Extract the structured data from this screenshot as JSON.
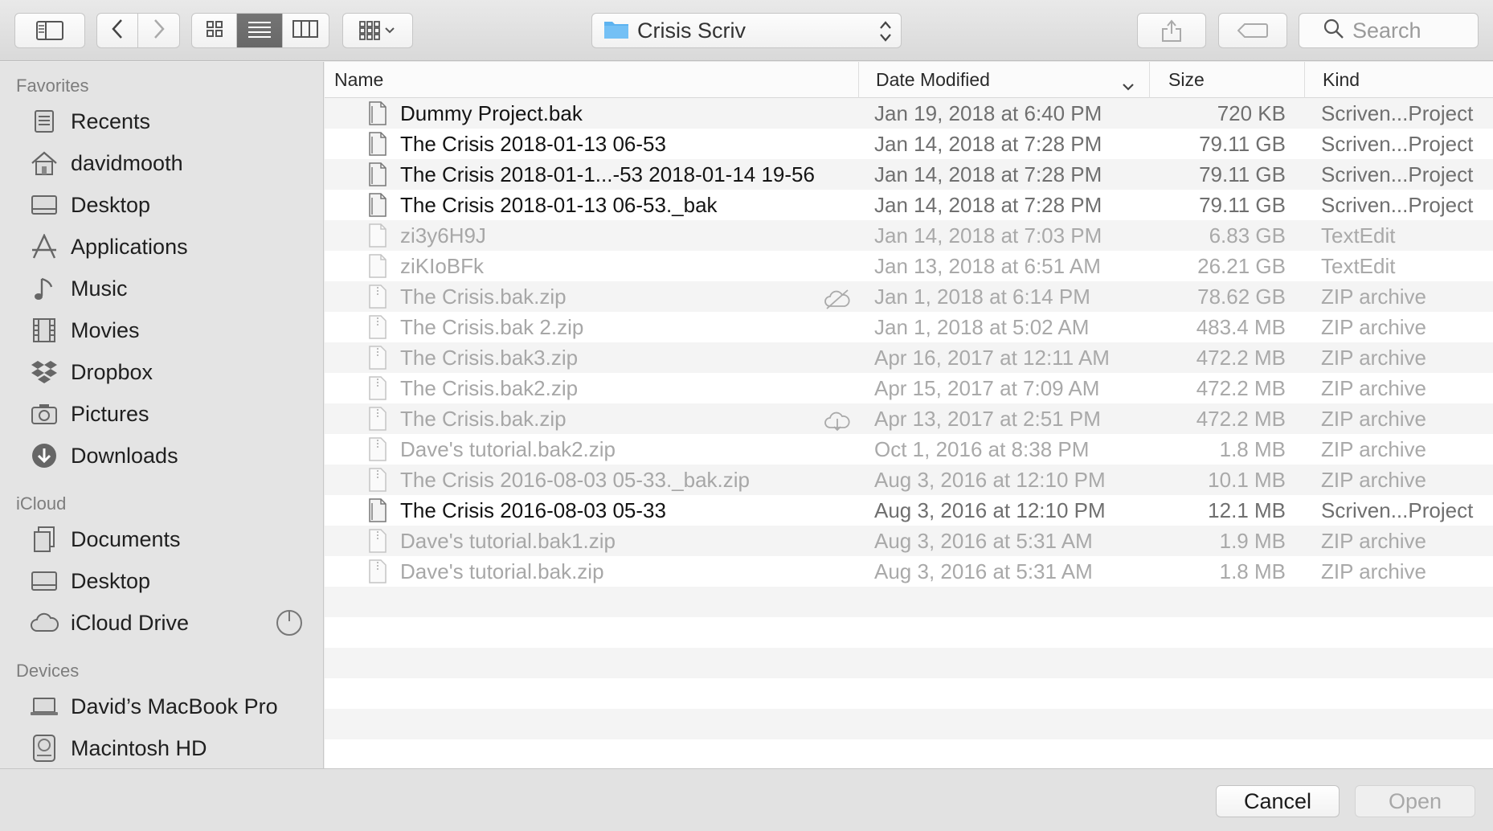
{
  "toolbar": {
    "location_name": "Crisis Scriv",
    "search_placeholder": "Search",
    "view_modes": [
      "icon-view",
      "list-view",
      "column-view"
    ],
    "active_view": "list-view"
  },
  "sidebar": {
    "sections": [
      {
        "title": "Favorites",
        "items": [
          {
            "label": "Recents",
            "icon": "recents-icon"
          },
          {
            "label": "davidmooth",
            "icon": "home-icon"
          },
          {
            "label": "Desktop",
            "icon": "desktop-icon"
          },
          {
            "label": "Applications",
            "icon": "applications-icon"
          },
          {
            "label": "Music",
            "icon": "music-icon"
          },
          {
            "label": "Movies",
            "icon": "movies-icon"
          },
          {
            "label": "Dropbox",
            "icon": "dropbox-icon"
          },
          {
            "label": "Pictures",
            "icon": "pictures-icon"
          },
          {
            "label": "Downloads",
            "icon": "downloads-icon"
          }
        ]
      },
      {
        "title": "iCloud",
        "items": [
          {
            "label": "Documents",
            "icon": "documents-icon"
          },
          {
            "label": "Desktop",
            "icon": "desktop-icon"
          },
          {
            "label": "iCloud Drive",
            "icon": "icloud-icon"
          }
        ]
      },
      {
        "title": "Devices",
        "items": [
          {
            "label": "David’s MacBook Pro",
            "icon": "laptop-icon"
          },
          {
            "label": "Macintosh HD",
            "icon": "hard-drive-icon"
          }
        ]
      }
    ]
  },
  "columns": {
    "name": "Name",
    "date": "Date Modified",
    "size": "Size",
    "kind": "Kind"
  },
  "files": [
    {
      "name": "Dummy Project.bak",
      "date": "Jan 19, 2018 at 6:40 PM",
      "size": "720 KB",
      "kind": "Scriven...Project",
      "enabled": true,
      "cloud": ""
    },
    {
      "name": "The Crisis 2018-01-13 06-53",
      "date": "Jan 14, 2018 at 7:28 PM",
      "size": "79.11 GB",
      "kind": "Scriven...Project",
      "enabled": true,
      "cloud": ""
    },
    {
      "name": "The Crisis 2018-01-1...-53 2018-01-14 19-56",
      "date": "Jan 14, 2018 at 7:28 PM",
      "size": "79.11 GB",
      "kind": "Scriven...Project",
      "enabled": true,
      "cloud": ""
    },
    {
      "name": "The Crisis 2018-01-13 06-53._bak",
      "date": "Jan 14, 2018 at 7:28 PM",
      "size": "79.11 GB",
      "kind": "Scriven...Project",
      "enabled": true,
      "cloud": ""
    },
    {
      "name": "zi3y6H9J",
      "date": "Jan 14, 2018 at 7:03 PM",
      "size": "6.83 GB",
      "kind": "TextEdit",
      "enabled": false,
      "cloud": ""
    },
    {
      "name": "ziKIoBFk",
      "date": "Jan 13, 2018 at 6:51 AM",
      "size": "26.21 GB",
      "kind": "TextEdit",
      "enabled": false,
      "cloud": ""
    },
    {
      "name": "The Crisis.bak.zip",
      "date": "Jan 1, 2018 at 6:14 PM",
      "size": "78.62 GB",
      "kind": "ZIP archive",
      "enabled": false,
      "cloud": "cloud-excluded-icon"
    },
    {
      "name": "The Crisis.bak 2.zip",
      "date": "Jan 1, 2018 at 5:02 AM",
      "size": "483.4 MB",
      "kind": "ZIP archive",
      "enabled": false,
      "cloud": ""
    },
    {
      "name": "The Crisis.bak3.zip",
      "date": "Apr 16, 2017 at 12:11 AM",
      "size": "472.2 MB",
      "kind": "ZIP archive",
      "enabled": false,
      "cloud": ""
    },
    {
      "name": "The Crisis.bak2.zip",
      "date": "Apr 15, 2017 at 7:09 AM",
      "size": "472.2 MB",
      "kind": "ZIP archive",
      "enabled": false,
      "cloud": ""
    },
    {
      "name": "The Crisis.bak.zip",
      "date": "Apr 13, 2017 at 2:51 PM",
      "size": "472.2 MB",
      "kind": "ZIP archive",
      "enabled": false,
      "cloud": "cloud-download-icon"
    },
    {
      "name": "Dave's tutorial.bak2.zip",
      "date": "Oct 1, 2016 at 8:38 PM",
      "size": "1.8 MB",
      "kind": "ZIP archive",
      "enabled": false,
      "cloud": ""
    },
    {
      "name": "The Crisis 2016-08-03 05-33._bak.zip",
      "date": "Aug 3, 2016 at 12:10 PM",
      "size": "10.1 MB",
      "kind": "ZIP archive",
      "enabled": false,
      "cloud": ""
    },
    {
      "name": "The Crisis 2016-08-03 05-33",
      "date": "Aug 3, 2016 at 12:10 PM",
      "size": "12.1 MB",
      "kind": "Scriven...Project",
      "enabled": true,
      "cloud": ""
    },
    {
      "name": "Dave's tutorial.bak1.zip",
      "date": "Aug 3, 2016 at 5:31 AM",
      "size": "1.9 MB",
      "kind": "ZIP archive",
      "enabled": false,
      "cloud": ""
    },
    {
      "name": "Dave's tutorial.bak.zip",
      "date": "Aug 3, 2016 at 5:31 AM",
      "size": "1.8 MB",
      "kind": "ZIP archive",
      "enabled": false,
      "cloud": ""
    }
  ],
  "buttons": {
    "cancel": "Cancel",
    "open": "Open"
  }
}
